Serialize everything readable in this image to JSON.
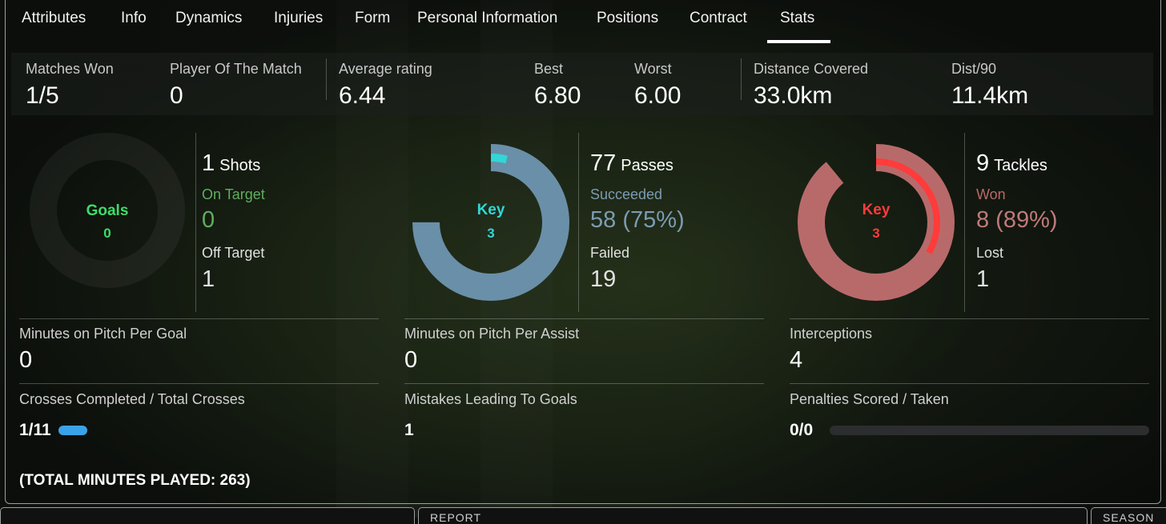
{
  "tabs": [
    {
      "label": "Attributes"
    },
    {
      "label": "Info"
    },
    {
      "label": "Dynamics"
    },
    {
      "label": "Injuries"
    },
    {
      "label": "Form"
    },
    {
      "label": "Personal Information"
    },
    {
      "label": "Positions"
    },
    {
      "label": "Contract"
    },
    {
      "label": "Stats",
      "active": true
    }
  ],
  "summary": {
    "matches_won": {
      "label": "Matches Won",
      "value": "1/5"
    },
    "player_of_match": {
      "label": "Player Of The Match",
      "value": "0"
    },
    "average_rating": {
      "label": "Average rating",
      "value": "6.44"
    },
    "best": {
      "label": "Best",
      "value": "6.80"
    },
    "worst": {
      "label": "Worst",
      "value": "6.00"
    },
    "distance": {
      "label": "Distance Covered",
      "value": "33.0km"
    },
    "dist90": {
      "label": "Dist/90",
      "value": "11.4km"
    }
  },
  "shots": {
    "donut_label": "Goals",
    "donut_value": "0",
    "total": "1",
    "total_label": "Shots",
    "on_target_label": "On Target",
    "on_target": "0",
    "off_target_label": "Off Target",
    "off_target": "1",
    "fill_fraction": 0,
    "color": "#3ddc6b"
  },
  "passes": {
    "donut_label": "Key",
    "donut_value": "3",
    "total": "77",
    "total_label": "Passes",
    "succeeded_label": "Succeeded",
    "succeeded": "58 (75%)",
    "failed_label": "Failed",
    "failed": "19",
    "success_fraction": 0.75,
    "key_fraction": 0.039,
    "color": "#6a8fa8",
    "key_color": "#33d6d6"
  },
  "tackles": {
    "donut_label": "Key",
    "donut_value": "3",
    "total": "9",
    "total_label": "Tackles",
    "won_label": "Won",
    "won": "8 (89%)",
    "lost_label": "Lost",
    "lost": "1",
    "won_fraction": 0.89,
    "key_fraction": 0.333,
    "color": "#b86a6a",
    "key_color": "#ff3b3b"
  },
  "bottom": {
    "min_per_goal": {
      "label": "Minutes on Pitch Per Goal",
      "value": "0"
    },
    "min_per_assist": {
      "label": "Minutes on Pitch Per Assist",
      "value": "0"
    },
    "interceptions": {
      "label": "Interceptions",
      "value": "4"
    },
    "crosses": {
      "label": "Crosses Completed / Total Crosses",
      "value": "1/11",
      "fraction": 0.09
    },
    "mistakes": {
      "label": "Mistakes Leading To Goals",
      "value": "1"
    },
    "penalties": {
      "label": "Penalties Scored / Taken",
      "value": "0/0",
      "fraction": 0
    }
  },
  "footer": {
    "total_minutes": "(TOTAL MINUTES PLAYED: 263)"
  },
  "bottom_buttons": [
    {
      "label": ""
    },
    {
      "label": "REPORT"
    },
    {
      "label": "SEASON"
    }
  ]
}
